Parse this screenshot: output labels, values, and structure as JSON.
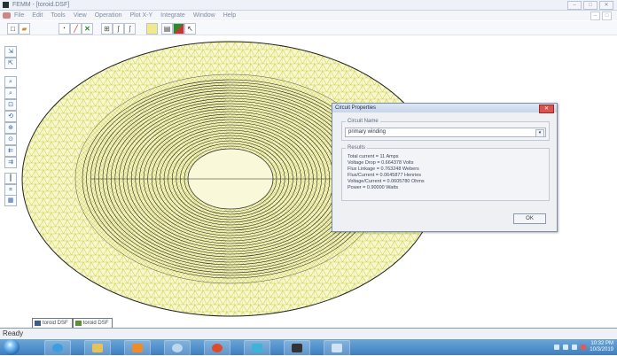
{
  "window": {
    "title": "FEMM - [toroid.DSF]",
    "controls": [
      "–",
      "□",
      "✕"
    ]
  },
  "menu": {
    "items": [
      "File",
      "Edit",
      "Tools",
      "View",
      "Operation",
      "Plot X-Y",
      "Integrate",
      "Window",
      "Help"
    ],
    "mdi_controls": [
      "–",
      "□",
      "✕"
    ]
  },
  "toolbar": {
    "icons": [
      "new-file-icon",
      "open-file-icon",
      "point-mode-icon",
      "segment-mode-icon",
      "delete-icon",
      "plot-icon",
      "graph-icon",
      "integrate-icon",
      "density-plot-icon",
      "mesh-icon",
      "color-icon",
      "pointer-icon"
    ]
  },
  "left_toolbar": {
    "icons": [
      "zoom-in-icon",
      "zoom-out-icon",
      "zoom-window-icon",
      "zoom-natural-icon",
      "pan-icon",
      "refresh-icon",
      "grid-icon",
      "snap-icon",
      "arrow-left-icon",
      "arrow-right-icon",
      "contour-icon",
      "vector-icon",
      "density-icon"
    ]
  },
  "tabs": [
    {
      "label": "toroid DSF",
      "active": false
    },
    {
      "label": "toroid DSF",
      "active": true
    }
  ],
  "status": {
    "text": "Ready"
  },
  "dialog": {
    "title": "Circuit Properties",
    "close": "✕",
    "circuit_name_label": "Circuit Name",
    "circuit_name_value": "primary winding",
    "results_label": "Results",
    "results": [
      "Total current = 11 Amps",
      "Voltage Drop = 0.664378 Volts",
      "Flux Linkage = 0.763248 Webers",
      "Flux/Current = 0.0645877 Henries",
      "Voltage/Current = 0.0605780 Ohms",
      "Power = 0.90000 Watts"
    ],
    "ok_label": "OK"
  },
  "taskbar": {
    "clock_time": "10:32 PM",
    "clock_date": "10/3/2019"
  },
  "colors": {
    "mesh": "#d9e24a",
    "winding": "#222222",
    "accent": "#2b63b5"
  }
}
